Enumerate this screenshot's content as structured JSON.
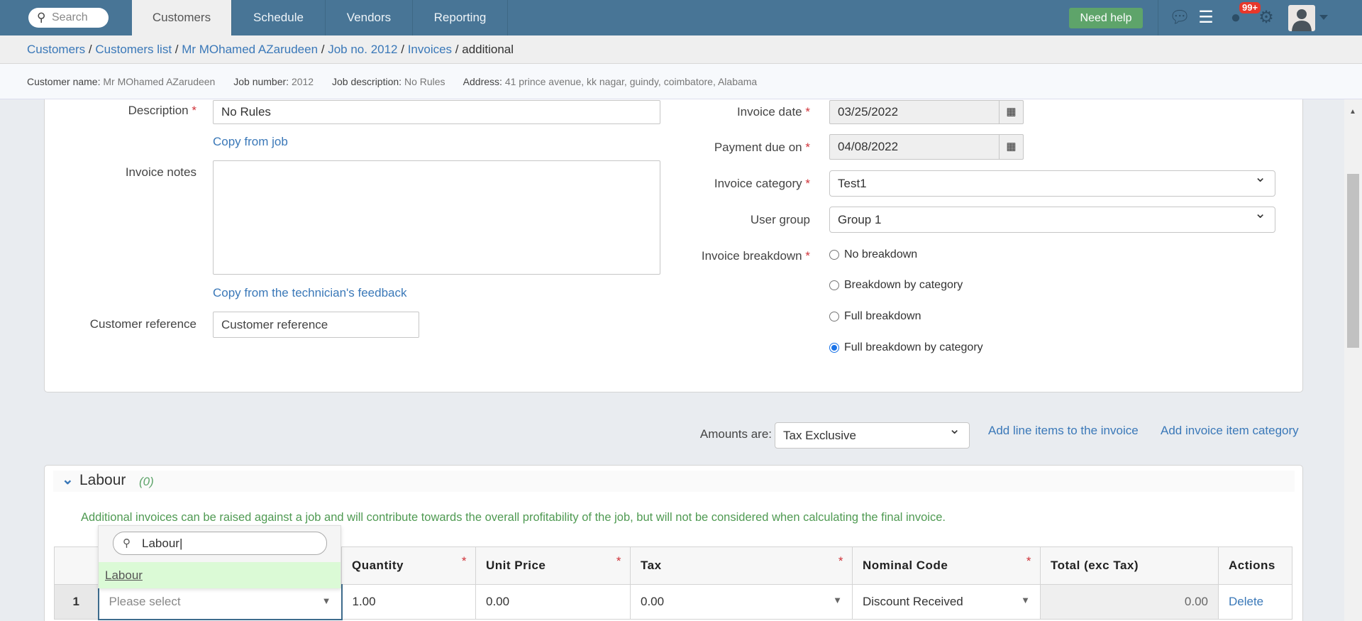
{
  "nav": {
    "search_placeholder": "Search",
    "tabs": [
      "Customers",
      "Schedule",
      "Vendors",
      "Reporting"
    ],
    "help": "Need help",
    "badge": "99+"
  },
  "breadcrumb": [
    "Customers",
    "Customers list",
    "Mr MOhamed AZarudeen",
    "Job no. 2012",
    "Invoices",
    "additional"
  ],
  "info": {
    "customer_label": "Customer name:",
    "customer": "Mr MOhamed AZarudeen",
    "job_label": "Job number:",
    "job": "2012",
    "desc_label": "Job description:",
    "desc": "No Rules",
    "addr_label": "Address:",
    "addr": "41 prince avenue, kk nagar, guindy, coimbatore, Alabama"
  },
  "form": {
    "description_label": "Description",
    "description": "No Rules",
    "copy_job": "Copy from job",
    "notes_label": "Invoice notes",
    "notes": "",
    "copy_feedback": "Copy from the technician's feedback",
    "custref_label": "Customer reference",
    "custref_placeholder": "Customer reference",
    "invoice_date_label": "Invoice date",
    "invoice_date": "03/25/2022",
    "due_label": "Payment due on",
    "due": "04/08/2022",
    "category_label": "Invoice category",
    "category": "Test1",
    "group_label": "User group",
    "group": "Group 1",
    "breakdown_label": "Invoice breakdown",
    "breakdown_options": [
      "No breakdown",
      "Breakdown by category",
      "Full breakdown",
      "Full breakdown by category"
    ],
    "breakdown_selected": 3
  },
  "amounts": {
    "label": "Amounts are:",
    "value": "Tax Exclusive",
    "add_line": "Add line items to the invoice",
    "add_category": "Add invoice item category"
  },
  "labour": {
    "title": "Labour",
    "count": "(0)",
    "note": "Additional invoices can be raised against a job and will contribute towards the overall profitability of the job, but will not be considered when calculating the final invoice.",
    "columns": [
      "",
      "",
      "Quantity",
      "Unit Price",
      "Tax",
      "Nominal Code",
      "Total (exc Tax)",
      "Actions"
    ],
    "row": {
      "num": "1",
      "item": "Please select",
      "qty": "1.00",
      "price": "0.00",
      "tax": "0.00",
      "nominal": "Discount Received",
      "total": "0.00",
      "action": "Delete"
    },
    "dropdown": {
      "search": "Labour",
      "option": "Labour"
    }
  }
}
